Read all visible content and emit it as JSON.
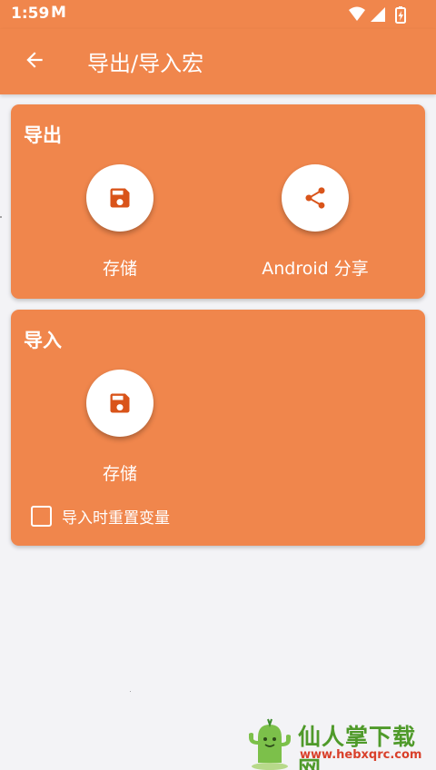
{
  "status_bar": {
    "time": "1:59",
    "notification_glyph": "M",
    "icons": [
      "wifi-icon",
      "signal-icon",
      "battery-icon"
    ]
  },
  "app_bar": {
    "back_icon": "arrow-left-icon",
    "title": "导出/导入宏"
  },
  "export_card": {
    "title": "导出",
    "storage_label": "存储",
    "storage_icon": "save-icon",
    "share_label": "Android 分享",
    "share_icon": "share-icon"
  },
  "import_card": {
    "title": "导入",
    "storage_label": "存储",
    "storage_icon": "save-icon",
    "reset_variables_label": "导入时重置变量",
    "reset_variables_checked": false
  },
  "watermark": {
    "text": "仙人掌下载网",
    "url": "www.hebxqrc.com"
  },
  "colors": {
    "primary": "#f0864c",
    "icon": "#d9541a",
    "background": "#f3f3f6"
  }
}
